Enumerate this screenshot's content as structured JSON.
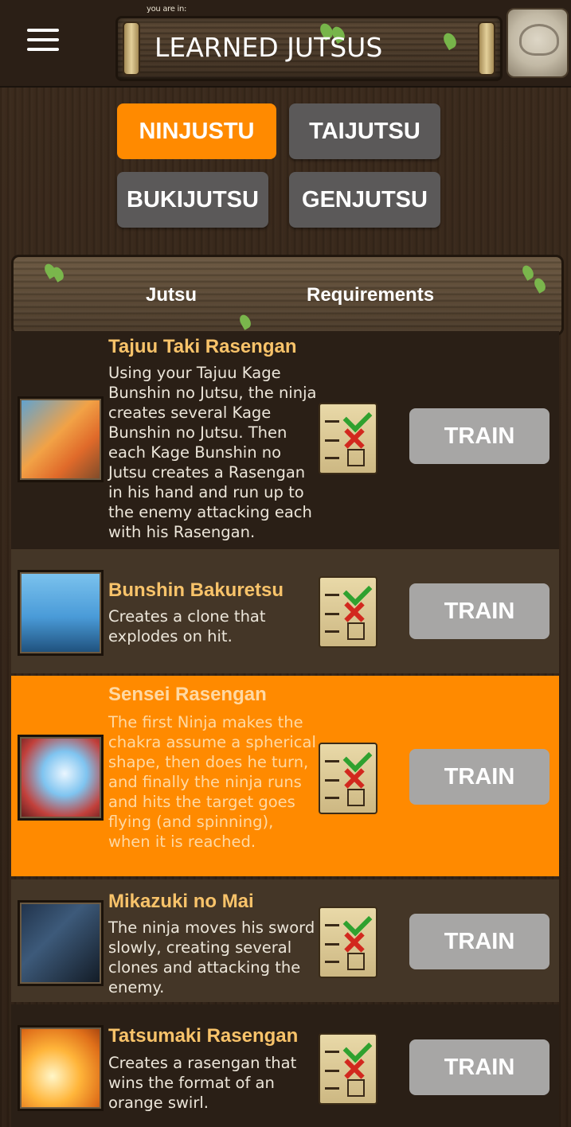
{
  "header": {
    "menu_icon": "hamburger-menu-icon",
    "location_caption": "you are in:",
    "title": "LEARNED JUTSUS",
    "bag_icon": "ninja-bag-icon"
  },
  "tabs": [
    {
      "label": "NINJUSTU",
      "active": true
    },
    {
      "label": "TAIJUTSU",
      "active": false
    },
    {
      "label": "BUKIJUTSU",
      "active": false
    },
    {
      "label": "GENJUTSU",
      "active": false
    }
  ],
  "table": {
    "col_jutsu": "Jutsu",
    "col_requirements": "Requirements",
    "train_label": "TRAIN",
    "requirements_icon": "checklist-scroll-icon"
  },
  "jutsus": [
    {
      "name": "Tajuu Taki Rasengan",
      "description": "Using your Tajuu Kage Bunshin no Jutsu, the ninja creates several Kage Bunshin no Jutsu. Then each Kage Bunshin no Jutsu creates a Rasengan in his hand and run up to the enemy attacking each with his Rasengan.",
      "image_icon": "naruto-portrait-image"
    },
    {
      "name": "Bunshin Bakuretsu",
      "description": "Creates a clone that explodes on hit.",
      "image_icon": "explosion-clone-image"
    },
    {
      "name": "Sensei Rasengan",
      "description": "The first Ninja makes the chakra assume a spherical shape, then does he turn, and finally the ninja runs and hits the target goes flying (and spinning), when it is reached.",
      "image_icon": "rasengan-sphere-image",
      "highlighted": true
    },
    {
      "name": "Mikazuki no Mai",
      "description": "The ninja moves his sword slowly, creating several clones and attacking the enemy.",
      "image_icon": "sword-ninja-image"
    },
    {
      "name": "Tatsumaki Rasengan",
      "description": "Creates a rasengan that wins the format of an orange swirl.",
      "image_icon": "orange-swirl-image"
    }
  ],
  "colors": {
    "accent": "#ff8a00",
    "tab_inactive": "#5b5959",
    "train_button": "#a7a6a5",
    "jutsu_name": "#f8c36a"
  }
}
